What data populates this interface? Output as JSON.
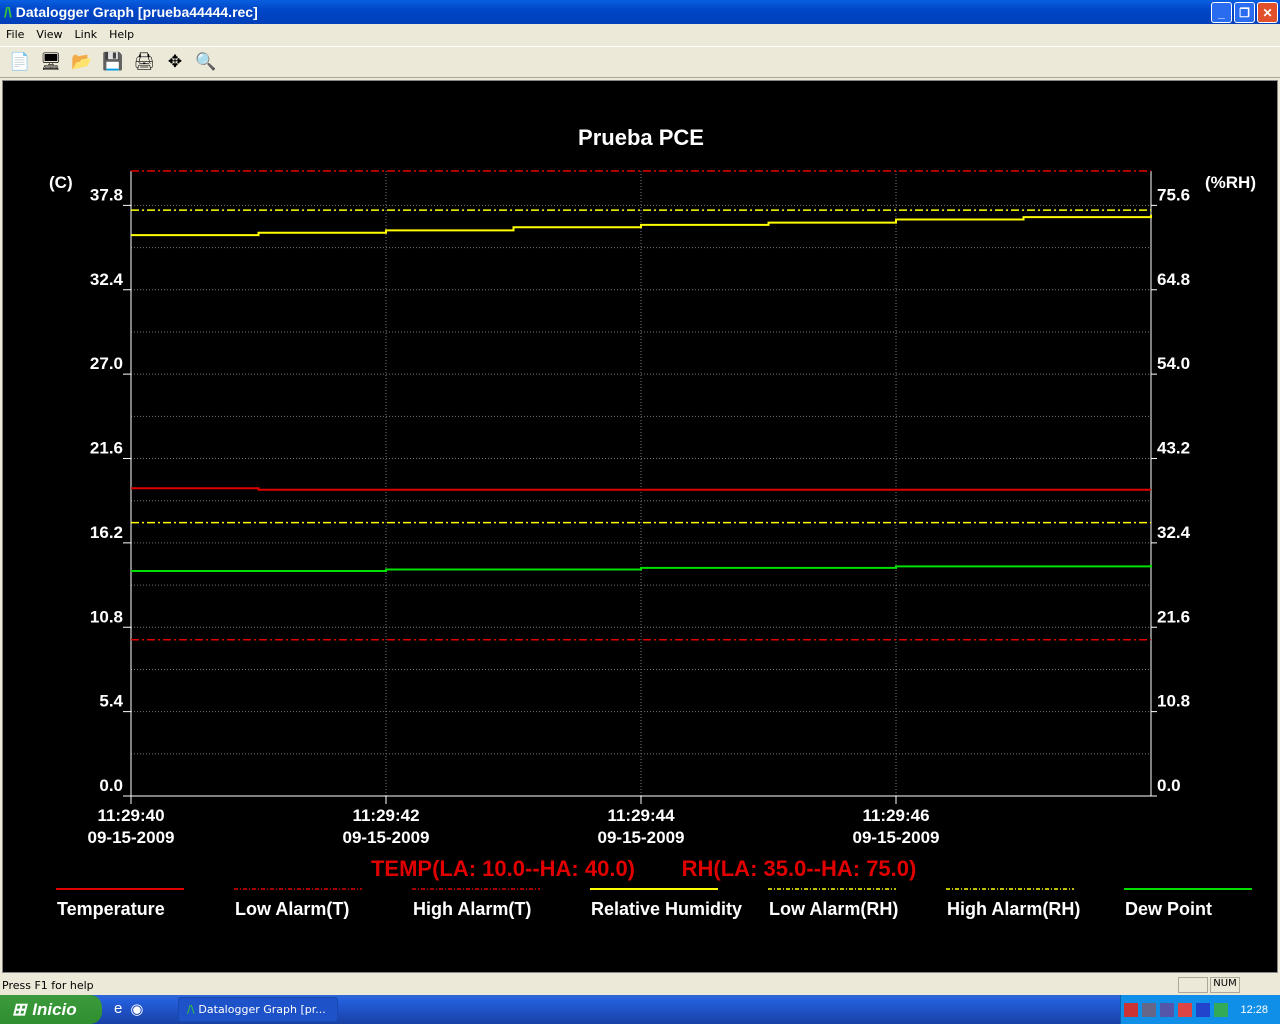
{
  "window": {
    "title": "Datalogger Graph [prueba44444.rec]",
    "minimize": "_",
    "restore": "❐",
    "close": "✕"
  },
  "menu": [
    "File",
    "View",
    "Link",
    "Help"
  ],
  "toolbar": [
    {
      "icon": "new-page-icon",
      "glyph": "📄"
    },
    {
      "icon": "monitor-icon",
      "glyph": "🖥"
    },
    {
      "icon": "open-folder-icon",
      "glyph": "📂"
    },
    {
      "icon": "save-icon",
      "glyph": "💾"
    },
    {
      "icon": "print-icon",
      "glyph": "🖨"
    },
    {
      "icon": "fit-view-icon",
      "glyph": "✥"
    },
    {
      "icon": "zoom-out-icon",
      "glyph": "🔍"
    }
  ],
  "chart_data": {
    "type": "line",
    "title": "Prueba PCE",
    "ylabel_left": "(C)",
    "ylabel_right": "(%RH)",
    "ylim_left": [
      0,
      40
    ],
    "ylim_right": [
      0,
      80
    ],
    "yticks_left": [
      "0.0",
      "5.4",
      "10.8",
      "16.2",
      "21.6",
      "27.0",
      "32.4",
      "37.8"
    ],
    "yticks_right": [
      "0.0",
      "10.8",
      "21.6",
      "32.4",
      "43.2",
      "54.0",
      "64.8",
      "75.6"
    ],
    "x": [
      "11:29:40",
      "11:29:41",
      "11:29:42",
      "11:29:43",
      "11:29:44",
      "11:29:45",
      "11:29:46",
      "11:29:47",
      "11:29:48"
    ],
    "xticks": [
      {
        "time": "11:29:40",
        "date": "09-15-2009"
      },
      {
        "time": "11:29:42",
        "date": "09-15-2009"
      },
      {
        "time": "11:29:44",
        "date": "09-15-2009"
      },
      {
        "time": "11:29:46",
        "date": "09-15-2009"
      }
    ],
    "grid": true,
    "series": [
      {
        "name": "Temperature",
        "axis": "left",
        "style": "solid",
        "color": "#e00000",
        "values": [
          19.7,
          19.6,
          19.6,
          19.6,
          19.6,
          19.6,
          19.6,
          19.6,
          19.6
        ]
      },
      {
        "name": "Low Alarm(T)",
        "axis": "left",
        "style": "dashdot",
        "color": "#e00000",
        "values": [
          10,
          10,
          10,
          10,
          10,
          10,
          10,
          10,
          10
        ]
      },
      {
        "name": "High Alarm(T)",
        "axis": "left",
        "style": "dashdot",
        "color": "#e00000",
        "values": [
          40,
          40,
          40,
          40,
          40,
          40,
          40,
          40,
          40
        ]
      },
      {
        "name": "Relative Humidity",
        "axis": "right",
        "style": "solid",
        "color": "#ffff00",
        "values": [
          71.8,
          72.1,
          72.4,
          72.8,
          73.1,
          73.4,
          73.8,
          74.1,
          74.4
        ]
      },
      {
        "name": "Low Alarm(RH)",
        "axis": "right",
        "style": "dashdot",
        "color": "#ffff00",
        "values": [
          35,
          35,
          35,
          35,
          35,
          35,
          35,
          35,
          35
        ]
      },
      {
        "name": "High Alarm(RH)",
        "axis": "right",
        "style": "dashdot",
        "color": "#ffff00",
        "values": [
          75,
          75,
          75,
          75,
          75,
          75,
          75,
          75,
          75
        ]
      },
      {
        "name": "Dew Point",
        "axis": "left",
        "style": "solid",
        "color": "#00e000",
        "values": [
          14.4,
          14.4,
          14.5,
          14.5,
          14.6,
          14.6,
          14.7,
          14.7,
          14.8
        ]
      }
    ],
    "annotation": {
      "temp": "TEMP(LA: 10.0--HA: 40.0)",
      "rh": "RH(LA: 35.0--HA: 75.0)"
    },
    "legend_placement": "bottom"
  },
  "status": {
    "help": "Press F1 for help",
    "num": "NUM"
  },
  "taskbar": {
    "start": "Inicio",
    "task": "Datalogger Graph [pr...",
    "clock": "12:28"
  }
}
